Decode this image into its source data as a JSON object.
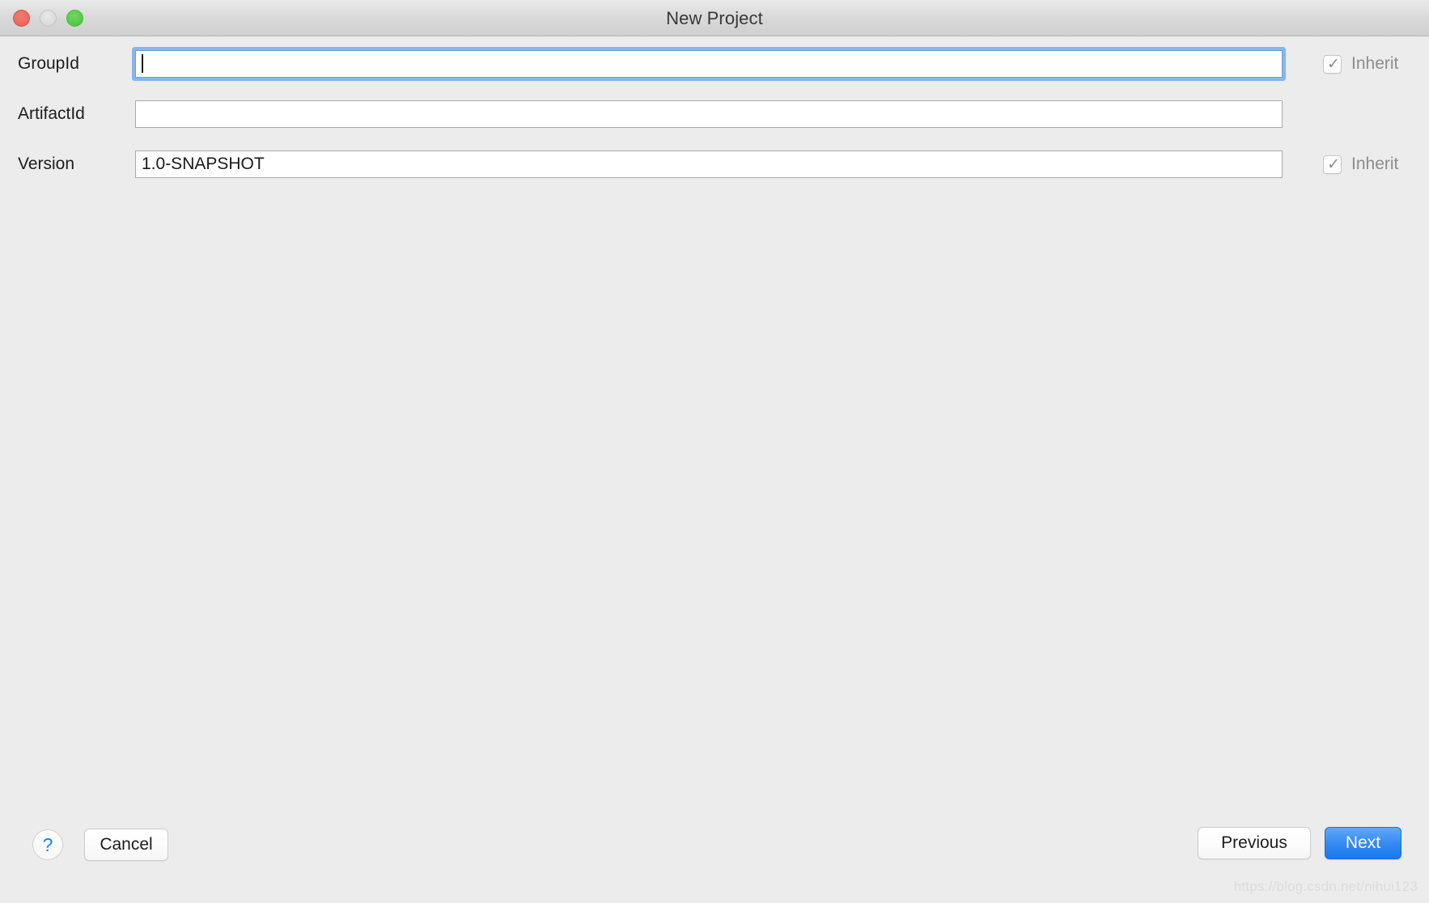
{
  "window": {
    "title": "New Project",
    "traffic_lights": {
      "close_label": "close",
      "minimize_label": "minimize",
      "zoom_label": "zoom"
    },
    "colors": {
      "background": "#ececec",
      "titlebar_top": "#e9e9e9",
      "titlebar_bottom": "#d0d0d0",
      "close_red": "#ec6a5e",
      "minimize_gray": "#dcdcdc",
      "zoom_green": "#56cc4a",
      "focus_ring_blue": "#74adec",
      "default_button_blue": "#3a8ef2",
      "help_glyph_blue": "#1a82f7",
      "disabled_text_gray": "#8c8c8c"
    }
  },
  "form": {
    "rows": [
      {
        "label": "GroupId",
        "value": "",
        "placeholder": "",
        "focused": true,
        "inherit": {
          "label": "Inherit",
          "checked": true,
          "checkmark": "✓",
          "disabled": true
        }
      },
      {
        "label": "ArtifactId",
        "value": "",
        "placeholder": "",
        "focused": false,
        "inherit": null
      },
      {
        "label": "Version",
        "value": "1.0-SNAPSHOT",
        "placeholder": "",
        "focused": false,
        "inherit": {
          "label": "Inherit",
          "checked": true,
          "checkmark": "✓",
          "disabled": true
        }
      }
    ]
  },
  "footer": {
    "help_glyph": "?",
    "cancel_label": "Cancel",
    "previous_label": "Previous",
    "next_label": "Next"
  },
  "watermark": {
    "text": "https://blog.csdn.net/nihui123"
  }
}
